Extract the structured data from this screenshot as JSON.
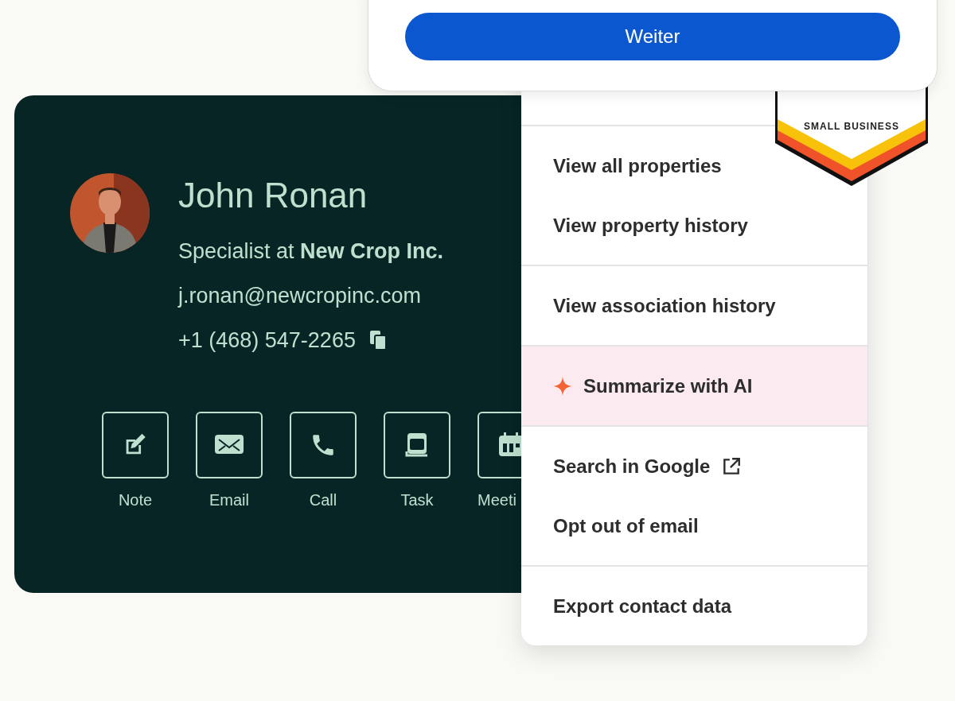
{
  "dialog": {
    "button": "Weiter"
  },
  "badge": {
    "subtitle": "SMALL BUSINESS"
  },
  "contact": {
    "name": "John Ronan",
    "title": "Specialist at **New Crop Inc.**",
    "email": "j.ronan@newcropinc.com",
    "phone": "+1 (468) 547-2265",
    "actions": [
      {
        "kind": "note",
        "label": "Note"
      },
      {
        "kind": "email",
        "label": "Email"
      },
      {
        "kind": "call",
        "label": "Call"
      },
      {
        "kind": "task",
        "label": "Task"
      },
      {
        "kind": "meeting",
        "label": "Meeti"
      }
    ]
  },
  "menu": {
    "groups": [
      [
        {
          "label": "View all properties",
          "kind": "plain",
          "highlighted": false
        },
        {
          "label": "View property history",
          "kind": "plain",
          "highlighted": false
        }
      ],
      [
        {
          "label": "View association history",
          "kind": "plain",
          "highlighted": false
        }
      ],
      [
        {
          "label": "Summarize with AI",
          "kind": "ai",
          "highlighted": true
        }
      ],
      [
        {
          "label": "Search in Google",
          "kind": "external",
          "highlighted": false
        },
        {
          "label": "Opt out of email",
          "kind": "plain",
          "highlighted": false
        }
      ],
      [
        {
          "label": "Export contact data",
          "kind": "plain",
          "highlighted": false
        }
      ]
    ]
  }
}
